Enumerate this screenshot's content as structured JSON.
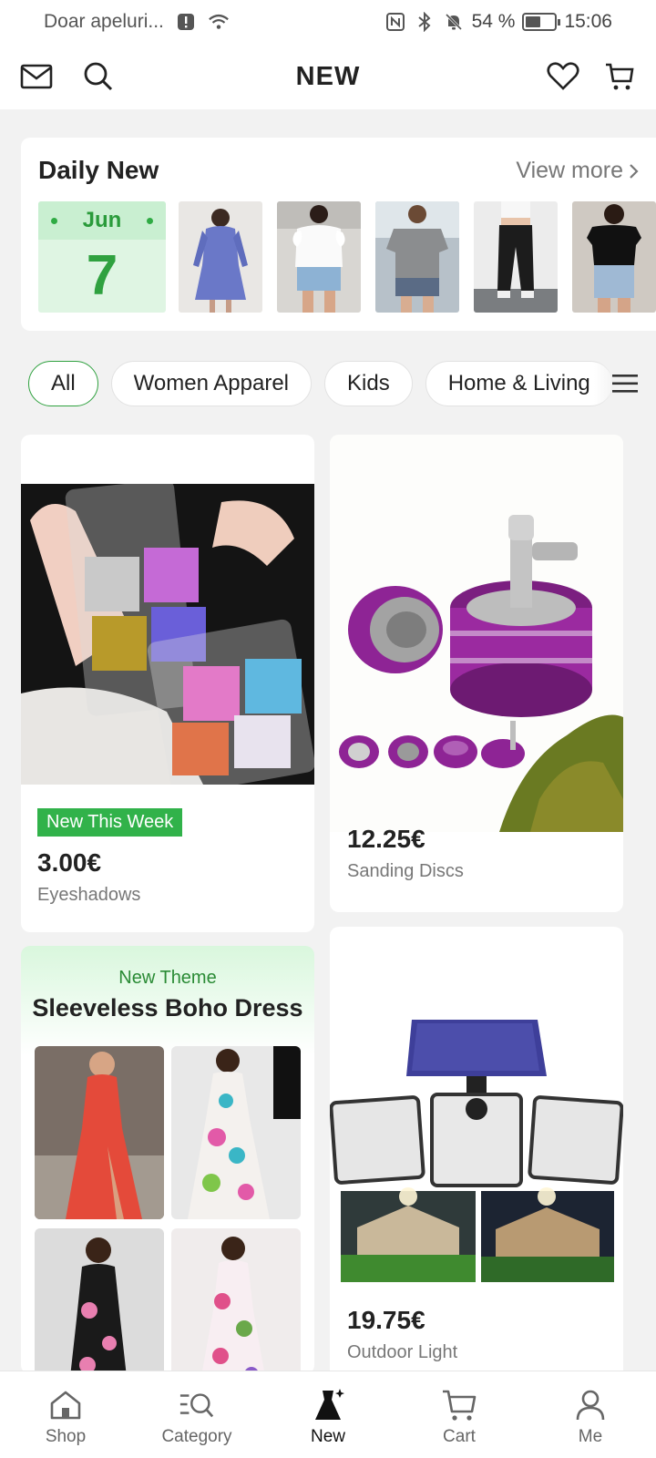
{
  "status_bar": {
    "carrier": "Doar apeluri...",
    "battery_percent": "54 %",
    "battery_level": 0.54,
    "time": "15:06"
  },
  "header": {
    "title": "NEW",
    "icons": [
      "mail-icon",
      "search-icon",
      "heart-icon",
      "cart-icon"
    ]
  },
  "daily_new": {
    "title": "Daily New",
    "view_more": "View more",
    "month": "Jun",
    "day": "7",
    "thumbnails": [
      "blue-dress",
      "white-blouse-shorts",
      "grey-tee-shorts",
      "black-pants",
      "black-top-jeans"
    ]
  },
  "categories": {
    "items": [
      "All",
      "Women Apparel",
      "Kids",
      "Home & Living"
    ],
    "selected": "All"
  },
  "products": [
    {
      "badge": "New This Week",
      "price": "3.00€",
      "name": "Eyeshadows"
    },
    {
      "price": "12.25€",
      "name": "Sanding Discs"
    },
    {
      "price": "19.75€",
      "name": "Outdoor Light"
    }
  ],
  "theme": {
    "kicker": "New Theme",
    "title": "Sleeveless Boho Dress"
  },
  "bottom_nav": [
    {
      "label": "Shop",
      "icon": "home-icon"
    },
    {
      "label": "Category",
      "icon": "category-search-icon"
    },
    {
      "label": "New",
      "icon": "dress-sparkle-icon"
    },
    {
      "label": "Cart",
      "icon": "cart-icon"
    },
    {
      "label": "Me",
      "icon": "person-icon"
    }
  ],
  "colors": {
    "accent": "#2fa13f",
    "badge": "#31b24a",
    "background": "#f2f2f2"
  }
}
